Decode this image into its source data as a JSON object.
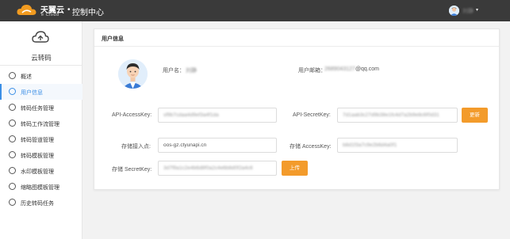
{
  "header": {
    "brand_cn": "天翼云",
    "brand_en": "e Cloud",
    "separator": "•",
    "console_title": "控制中心",
    "user_name": "刘静",
    "caret": "▾"
  },
  "sidebar": {
    "title": "云转码",
    "items": [
      {
        "label": "概述",
        "icon": "overview-icon"
      },
      {
        "label": "用户信息",
        "icon": "user-info-icon",
        "active": true
      },
      {
        "label": "转码任务管理",
        "icon": "task-icon"
      },
      {
        "label": "转码工作流管理",
        "icon": "workflow-icon"
      },
      {
        "label": "转码管道管理",
        "icon": "pipeline-icon"
      },
      {
        "label": "转码模板管理",
        "icon": "template-icon"
      },
      {
        "label": "水印模板管理",
        "icon": "watermark-icon"
      },
      {
        "label": "缩略图模板管理",
        "icon": "thumbnail-icon"
      },
      {
        "label": "历史转码任务",
        "icon": "history-icon"
      }
    ]
  },
  "panel": {
    "title": "用户信息",
    "username_label": "用户名：",
    "username_value": "刘静",
    "email_label": "用户邮箱：",
    "email_prefix": "2689043127",
    "email_suffix": "@qq.com",
    "api_access_label": "API-AccessKey:",
    "api_access_value": "sf9b7cdaa4d9ef3a4f1da",
    "api_secret_label": "API-SecretKey:",
    "api_secret_value": "7d1aab3c27d9b38e1fc4d7a2b9e8c6f0d31",
    "refresh_button": "更新",
    "endpoint_label": "存储接入点:",
    "endpoint_value": "oos-gz.ctyunapi.cn",
    "storage_access_label": "存储 AccessKey:",
    "storage_access_value": "b8d1f3a7c9e2b6d4a0f1",
    "storage_secret_label": "存储 SecretKey:",
    "storage_secret_value": "3d7f9a1c2e4b6d8f0a2c4e6b8d0f2a4c6",
    "upload_button": "上传"
  },
  "colors": {
    "topbar": "#3a3a3a",
    "accent": "#3a8ee6",
    "button": "#f39b2b"
  }
}
